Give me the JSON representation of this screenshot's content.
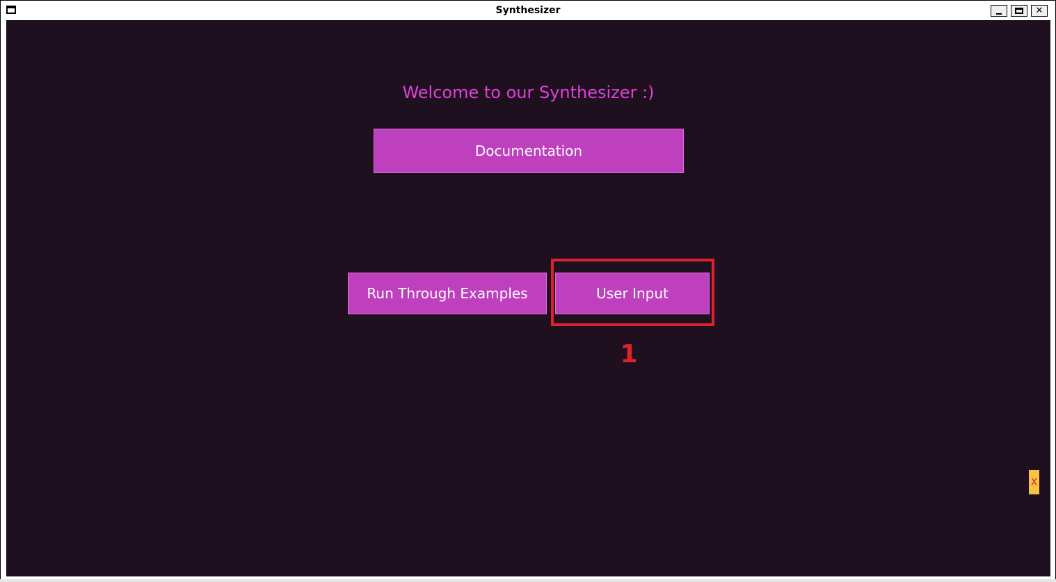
{
  "window": {
    "title": "Synthesizer",
    "controls": {
      "minimize_icon": "minimize-icon",
      "maximize_icon": "maximize-icon",
      "close_label": "✕"
    }
  },
  "main": {
    "welcome_text": "Welcome to our Synthesizer :)",
    "documentation_label": "Documentation",
    "run_examples_label": "Run Through Examples",
    "user_input_label": "User Input"
  },
  "annotation": {
    "marker_number": "1",
    "color": "#e0202a"
  },
  "side_tab": {
    "label": "X"
  },
  "colors": {
    "background": "#1f1020",
    "accent": "#bf40bf",
    "welcome_text": "#e040d8"
  }
}
